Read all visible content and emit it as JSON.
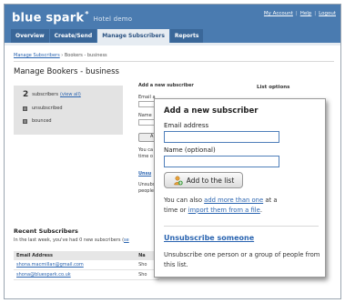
{
  "header": {
    "logo": "blue spark",
    "logo_mark": "*",
    "subtitle": "Hotel demo",
    "links": [
      "My Account",
      "Help",
      "Logout"
    ],
    "link_separator": "|"
  },
  "tabs": [
    {
      "label": "Overview",
      "active": false
    },
    {
      "label": "Create/Send",
      "active": false
    },
    {
      "label": "Manage Subscribers",
      "active": true
    },
    {
      "label": "Reports",
      "active": false
    }
  ],
  "breadcrumb": {
    "link": "Manage Subscribers",
    "current": "› Bookers - business"
  },
  "page_title": "Manage Bookers - business",
  "stats": {
    "count": "2",
    "count_label": "subscribers",
    "view_all": "(view all)",
    "unsubscribed": "unsubscribed",
    "bounced": "bounced"
  },
  "background_form": {
    "heading": "Add a new subscriber",
    "email_label": "Email a",
    "name_label": "Name",
    "button_label": "A",
    "helper_line1": "You ca",
    "helper_line2": "time o",
    "unsub_link": "Unsu",
    "unsub_text_1": "Unsubs",
    "unsub_text_2": "people",
    "list_options": "List options"
  },
  "recent": {
    "title": "Recent Subscribers",
    "text": "In the last week, you've had 0 new subscribers (",
    "text_link": "se",
    "columns": [
      "Email Address",
      "Na"
    ],
    "rows": [
      {
        "email": "shona.macmillan@gmail.com",
        "name": "Sho"
      },
      {
        "email": "shona@bluespark.co.uk",
        "name": "Sho"
      }
    ]
  },
  "popup": {
    "title": "Add a new subscriber",
    "email_label": "Email address",
    "email_value": "",
    "name_label": "Name (optional)",
    "name_value": "",
    "button_label": "Add to the list",
    "also_prefix": "You can also",
    "also_link1": "add more than one",
    "also_mid1": "at a",
    "also_mid2": "time or",
    "also_link2": "import them from a file",
    "also_suffix": ".",
    "unsub_link": "Unsubscribe someone",
    "unsub_text": "Unsubscribe one person or a group of people from this list."
  },
  "colors": {
    "header_blue": "#4a7bb0",
    "link_blue": "#2a64b0",
    "input_border": "#4f7fba"
  },
  "icons": {
    "add_button_icon": "add-person-icon"
  }
}
